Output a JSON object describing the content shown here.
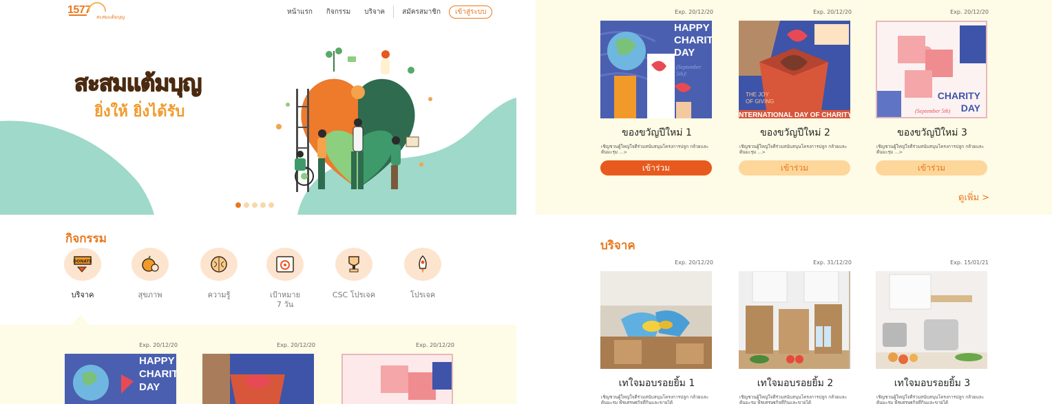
{
  "header": {
    "logo_number": "1577",
    "logo_text": "สะสมแต้มบุญ",
    "nav": [
      "หน้าแรก",
      "กิจกรรม",
      "บริจาค",
      "สมัครสมาชิก"
    ],
    "login_label": "เข้าสู่ระบบ"
  },
  "hero": {
    "title": "สะสมแต้มบุญ",
    "subtitle": "ยิ่งให้ ยิ่งได้รับ",
    "slide_count": 5,
    "active_slide": 1
  },
  "activities": {
    "title": "กิจกรรม",
    "categories": [
      {
        "label": "บริจาค",
        "icon": "donate-icon"
      },
      {
        "label": "สุขภาพ",
        "icon": "health-apple-icon"
      },
      {
        "label": "ความรู้",
        "icon": "knowledge-brain-icon"
      },
      {
        "label": "เป้าหมาย\n7 วัน",
        "icon": "target-calendar-icon"
      },
      {
        "label": "CSC โปรเจค",
        "icon": "trophy-icon"
      },
      {
        "label": "โปรเจค",
        "icon": "rocket-icon"
      }
    ],
    "mini_cards": [
      {
        "exp": "Exp. 20/12/20"
      },
      {
        "exp": "Exp. 20/12/20"
      },
      {
        "exp": "Exp. 20/12/20"
      }
    ]
  },
  "event_cards": {
    "items": [
      {
        "exp": "Exp. 20/12/20",
        "title": "ของขวัญปีใหม่ 1",
        "desc": "เชิญชวนผู้ใหญ่ใจดีร่วมสนับสนุนโครงการปลูก กล้วยและต้นมะรุม ...>",
        "join": "เข้าร่วม",
        "art_text": "HAPPY CHARITY DAY",
        "art_sub": "(September 5th)!"
      },
      {
        "exp": "Exp. 20/12/20",
        "title": "ของขวัญปีใหม่ 2",
        "desc": "เชิญชวนผู้ใหญ่ใจดีร่วมสนับสนุนโครงการปลูก กล้วยและต้นมะรุม ...>",
        "join": "เข้าร่วม",
        "art_text": "INTERNATIONAL DAY OF CHARITY",
        "art_sub": "THE JOY OF GIVING"
      },
      {
        "exp": "Exp. 20/12/20",
        "title": "ของขวัญปีใหม่ 3",
        "desc": "เชิญชวนผู้ใหญ่ใจดีร่วมสนับสนุนโครงการปลูก กล้วยและต้นมะรุม ...>",
        "join": "เข้าร่วม",
        "art_text": "CHARITY DAY",
        "art_sub": "(September 5th)"
      }
    ],
    "more": "ดูเพิ่ม >"
  },
  "donation": {
    "title": "บริจาค",
    "items": [
      {
        "exp": "Exp. 20/12/20",
        "title": "เทใจมอบรอยยิ้ม 1",
        "desc": "เชิญชวนผู้ใหญ่ใจดีร่วมสนับสนุนโครงการปลูก กล้วยและต้นมะรุม   พืชเศรษฐกิจที่กินและขายได้"
      },
      {
        "exp": "Exp. 31/12/20",
        "title": "เทใจมอบรอยยิ้ม 2",
        "desc": "เชิญชวนผู้ใหญ่ใจดีร่วมสนับสนุนโครงการปลูก กล้วยและต้นมะรุม   พืชเศรษฐกิจที่กินและขายได้"
      },
      {
        "exp": "Exp. 15/01/21",
        "title": "เทใจมอบรอยยิ้ม 3",
        "desc": "เชิญชวนผู้ใหญ่ใจดีร่วมสนับสนุนโครงการปลูก กล้วยและต้นมะรุม   พืชเศรษฐกิจที่กินและขายได้"
      }
    ]
  },
  "colors": {
    "accent": "#e8771e",
    "button_primary": "#e8591e",
    "button_light": "#fdd69a",
    "band": "#fefbe6",
    "mint": "#9ed9c9"
  }
}
